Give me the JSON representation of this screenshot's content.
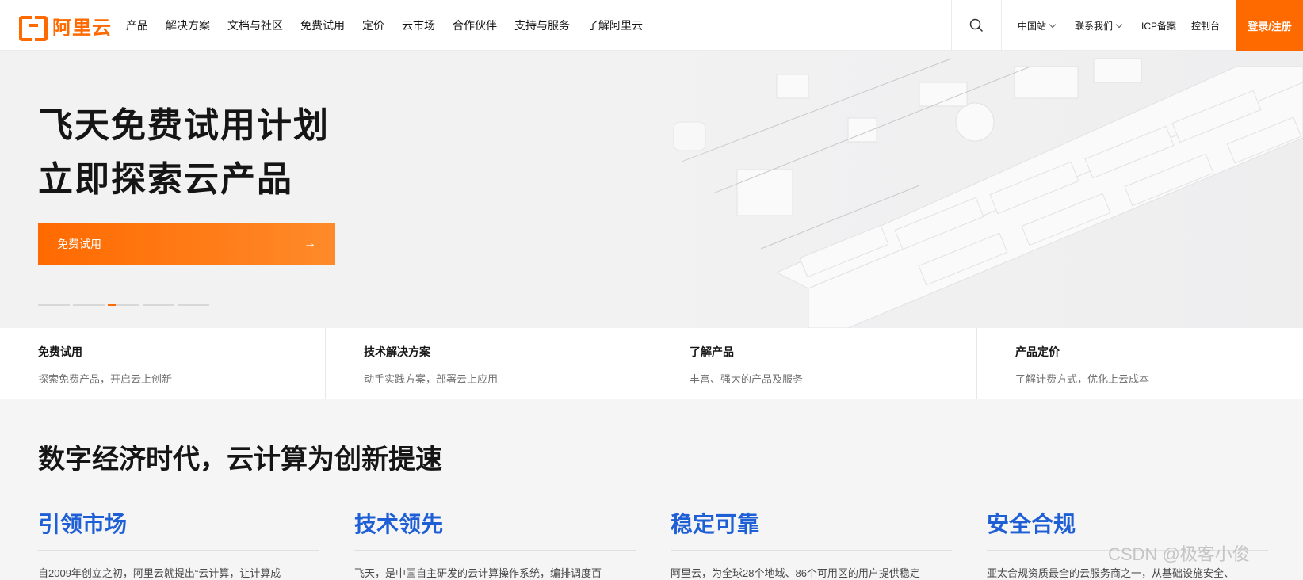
{
  "header": {
    "logo_text": "阿里云",
    "nav": [
      "产品",
      "解决方案",
      "文档与社区",
      "免费试用",
      "定价",
      "云市场",
      "合作伙伴",
      "支持与服务",
      "了解阿里云"
    ],
    "site": "中国站",
    "contact": "联系我们",
    "icp": "ICP备案",
    "console": "控制台",
    "login": "登录/注册"
  },
  "hero": {
    "title_line1": "飞天免费试用计划",
    "title_line2": "立即探索云产品",
    "cta_label": "免费试用",
    "slides_count": 5,
    "active_slide": 3
  },
  "quick_entries": [
    {
      "title": "免费试用",
      "desc": "探索免费产品，开启云上创新"
    },
    {
      "title": "技术解决方案",
      "desc": "动手实践方案，部署云上应用"
    },
    {
      "title": "了解产品",
      "desc": "丰富、强大的产品及服务"
    },
    {
      "title": "产品定价",
      "desc": "了解计费方式，优化上云成本"
    }
  ],
  "section": {
    "title": "数字经济时代，云计算为创新提速",
    "items": [
      {
        "title": "引领市场",
        "text": "自2009年创立之初，阿里云就提出“云计算，让计算成"
      },
      {
        "title": "技术领先",
        "text": "飞天，是中国自主研发的云计算操作系统，编排调度百"
      },
      {
        "title": "稳定可靠",
        "text": "阿里云，为全球28个地域、86个可用区的用户提供稳定"
      },
      {
        "title": "安全合规",
        "text": "亚太合规资质最全的云服务商之一，从基础设施安全、"
      }
    ]
  },
  "watermark": "CSDN @极客小俊",
  "colors": {
    "brand": "#ff6a00",
    "accent_blue": "#1f5fd6"
  }
}
